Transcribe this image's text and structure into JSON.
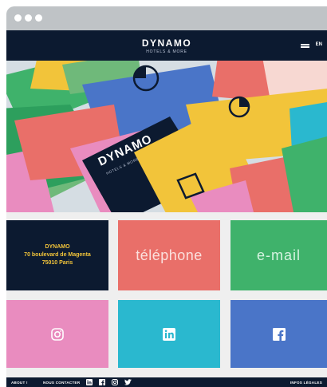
{
  "brand": {
    "name": "DYNAMO",
    "tagline": "HOTELS & MORE"
  },
  "header": {
    "language": "EN",
    "menu_icon": "hamburger-menu-icon"
  },
  "hero": {
    "card_brand": "DYNAMO",
    "card_tagline": "HOTELS & MORE"
  },
  "address": {
    "line1": "DYNAMO",
    "line2": "70 boulevard de Magenta",
    "line3": "75010 Paris"
  },
  "tiles": {
    "phone": "téléphone",
    "email": "e-mail",
    "instagram_icon": "instagram-icon",
    "linkedin_icon": "linkedin-icon",
    "facebook_icon": "facebook-icon"
  },
  "footer": {
    "about": "ABOUT !",
    "contact": "NOUS CONTACTER",
    "legal": "INFOS LÉGALES"
  },
  "colors": {
    "navy": "#0c1a30",
    "yellow": "#f2c43a",
    "coral": "#e96f69",
    "green": "#3fb26b",
    "pink": "#e98cbf",
    "cyan": "#2ab8cf",
    "blue": "#4a75c8"
  }
}
